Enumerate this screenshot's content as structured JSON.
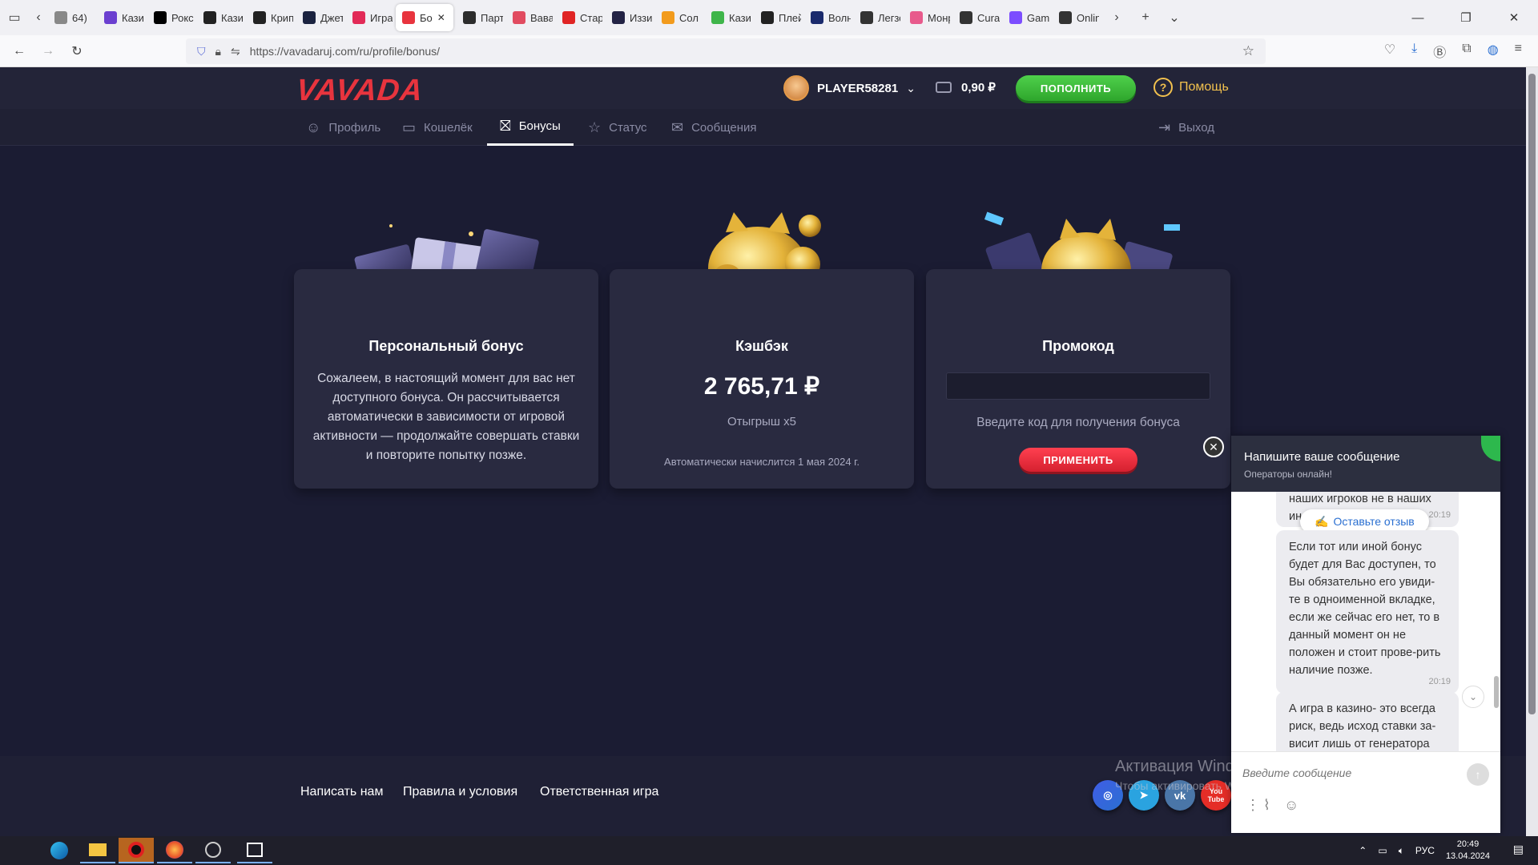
{
  "browser": {
    "tabs": [
      {
        "label": "64)",
        "color": "#888888"
      },
      {
        "label": "Казин",
        "color": "#6b3fd0"
      },
      {
        "label": "Рокс",
        "color": "#000000"
      },
      {
        "label": "Казин",
        "color": "#222222"
      },
      {
        "label": "Крипт",
        "color": "#222222"
      },
      {
        "label": "Джет",
        "color": "#1b2340"
      },
      {
        "label": "Играй",
        "color": "#e22a57"
      },
      {
        "label": "Бо",
        "color": "#e8343e",
        "active": true
      },
      {
        "label": "Партн",
        "color": "#2c2c2c"
      },
      {
        "label": "Вавад",
        "color": "#e14b60"
      },
      {
        "label": "Стард",
        "color": "#e02424"
      },
      {
        "label": "Иззи",
        "color": "#222244"
      },
      {
        "label": "Сол К",
        "color": "#f29b1d"
      },
      {
        "label": "Казин",
        "color": "#3fb54a"
      },
      {
        "label": "Плей",
        "color": "#222222"
      },
      {
        "label": "Волна",
        "color": "#1a2a6c"
      },
      {
        "label": "Легзо",
        "color": "#333333"
      },
      {
        "label": "Монр",
        "color": "#e85a8c"
      },
      {
        "label": "Curaç",
        "color": "#333333"
      },
      {
        "label": "Gama",
        "color": "#7c4dff"
      },
      {
        "label": "Online",
        "color": "#333333"
      }
    ],
    "url": "https://vavadaruj.com/ru/profile/bonus/"
  },
  "header": {
    "logo": "VAVADA",
    "username": "PLAYER58281",
    "balance": "0,90 ₽",
    "deposit_label": "ПОПОЛНИТЬ",
    "help_label": "Помощь"
  },
  "subnav": {
    "profile": "Профиль",
    "wallet": "Кошелёк",
    "bonuses": "Бонусы",
    "status": "Статус",
    "messages": "Сообщения",
    "logout": "Выход"
  },
  "cards": {
    "personal": {
      "title": "Персональный бонус",
      "text": "Сожалеем, в настоящий момент для вас нет доступного бонуса. Он рассчитывается автоматически в зависимости от игровой активности — продолжайте совершать ставки и повторите попытку позже."
    },
    "cashback": {
      "title": "Кэшбэк",
      "amount": "2 765,71 ₽",
      "wager": "Отыгрыш x5",
      "note": "Автоматически начислится 1 мая 2024 г."
    },
    "promo": {
      "title": "Промокод",
      "input_value": "",
      "hint": "Введите код для получения бонуса",
      "apply_label": "ПРИМЕНИТЬ"
    }
  },
  "footer": {
    "write_us": "Написать нам",
    "terms": "Правила и условия",
    "responsible": "Ответственная игра",
    "socials": [
      "instagram",
      "telegram",
      "vk",
      "youtube"
    ],
    "youtube_text": "You Tube"
  },
  "windows_activation": {
    "title": "Активация Windows",
    "subtitle": "Чтобы активировать Windows, перейдите в раздел \"Параметры\"."
  },
  "chat": {
    "header_title": "Напишите ваше сообщение",
    "header_subtitle": "Операторы онлайн!",
    "review_label": "Оставьте отзыв",
    "messages": [
      {
        "text": "наших игроков не в наших ин...",
        "time": "20:19"
      },
      {
        "text": "Если тот или иной бонус будет для Вас доступен, то Вы обязательно его увиди-те в одноименной вкладке, если же сейчас его нет, то в данный момент он не положен и стоит прове-рить наличие позже.",
        "time": "20:19"
      },
      {
        "text": "А игра в казино- это всегда риск, ведь исход ставки за-висит лишь от генератора",
        "time": ""
      }
    ],
    "input_placeholder": "Введите сообщение"
  },
  "taskbar": {
    "lang": "РУС",
    "time": "20:49",
    "date": "13.04.2024"
  }
}
